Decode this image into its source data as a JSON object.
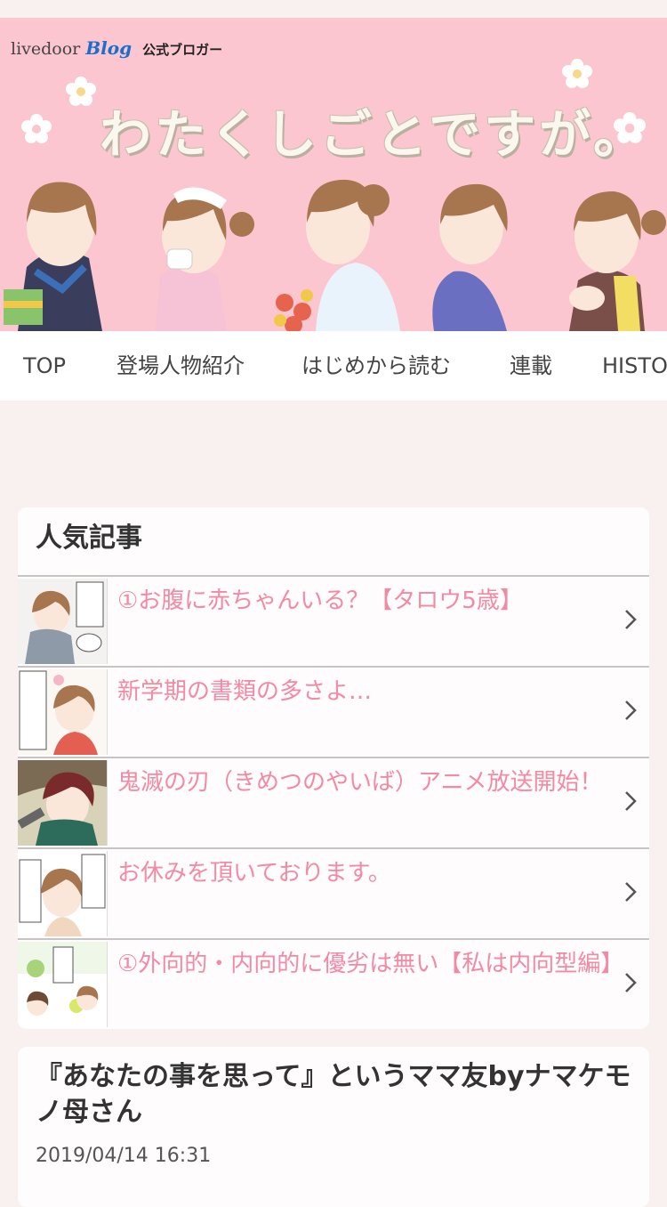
{
  "banner": {
    "logo_brand": "livedoor",
    "logo_blog": "Blog",
    "logo_official": "公式ブロガー",
    "site_title": "わたくしごとですが。"
  },
  "nav": {
    "items": [
      {
        "label": "TOP"
      },
      {
        "label": "登場人物紹介"
      },
      {
        "label": "はじめから読む"
      },
      {
        "label": "連載"
      },
      {
        "label": "HISTORY"
      }
    ]
  },
  "popular": {
    "heading": "人気記事",
    "items": [
      {
        "title": "①お腹に赤ちゃんいる？【タロウ5歳】"
      },
      {
        "title": "新学期の書類の多さよ…"
      },
      {
        "title": "鬼滅の刃（きめつのやいば）アニメ放送開始！"
      },
      {
        "title": "お休みを頂いております。"
      },
      {
        "title": "①外向的・内向的に優劣は無い【私は内向型編】"
      }
    ]
  },
  "article": {
    "title": "『あなたの事を思って』というママ友byナマケモノ母さん",
    "date": "2019/04/14 16:31"
  },
  "colors": {
    "banner_bg": "#fbc6d0",
    "link_pink": "#f28aa4",
    "page_bg": "#f9f1f0"
  }
}
